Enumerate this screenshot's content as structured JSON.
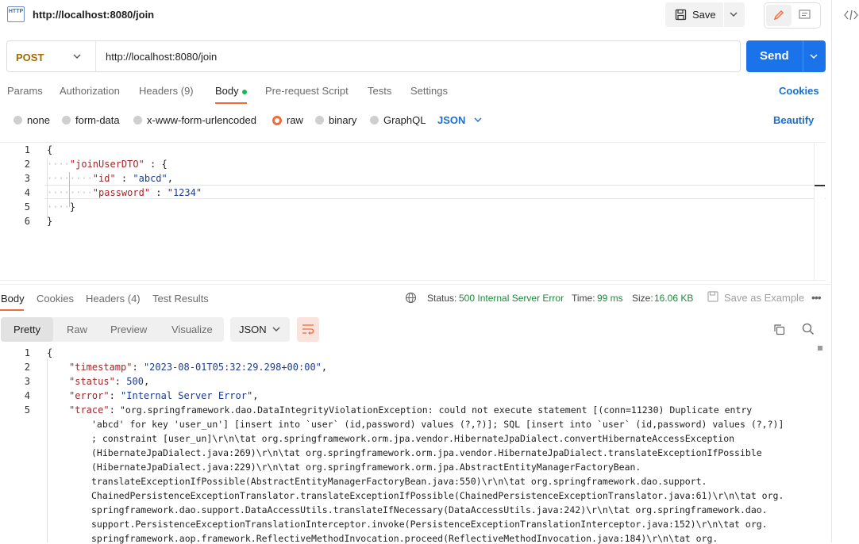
{
  "tab": {
    "icon_text": "HTTP",
    "title": "http://localhost:8080/join"
  },
  "toolbar": {
    "save_label": "Save"
  },
  "request": {
    "method": "POST",
    "url": "http://localhost:8080/join",
    "send_label": "Send"
  },
  "request_tabs": {
    "params": "Params",
    "authorization": "Authorization",
    "headers": "Headers (9)",
    "body": "Body",
    "prerequest": "Pre-request Script",
    "tests": "Tests",
    "settings": "Settings",
    "cookies": "Cookies"
  },
  "body_types": {
    "none": "none",
    "form_data": "form-data",
    "urlencoded": "x-www-form-urlencoded",
    "raw": "raw",
    "binary": "binary",
    "graphql": "GraphQL",
    "format": "JSON",
    "beautify": "Beautify"
  },
  "request_body": {
    "line_numbers": [
      "1",
      "2",
      "3",
      "4",
      "5",
      "6"
    ],
    "l1": "{",
    "l2_key": "\"joinUserDTO\"",
    "l2_rest": " : {",
    "l3_key": "\"id\"",
    "l3_colon": " : ",
    "l3_val": "\"abcd\"",
    "l3_comma": ",",
    "l4_key": "\"password\"",
    "l4_colon": " : ",
    "l4_val": "\"1234\"",
    "l5": "}",
    "l6": "}"
  },
  "response_tabs": {
    "body": "Body",
    "cookies": "Cookies",
    "headers": "Headers (4)",
    "test_results": "Test Results"
  },
  "response_meta": {
    "status_label": "Status:",
    "status_value": "500 Internal Server Error",
    "time_label": "Time:",
    "time_value": "99 ms",
    "size_label": "Size:",
    "size_value": "16.06 KB",
    "save_example": "Save as Example"
  },
  "view_modes": {
    "pretty": "Pretty",
    "raw": "Raw",
    "preview": "Preview",
    "visualize": "Visualize",
    "format": "JSON"
  },
  "response_body": {
    "line_numbers": [
      "1",
      "2",
      "3",
      "4",
      "5"
    ],
    "l1": "{",
    "l2_key": "\"timestamp\"",
    "l2_val": "\"2023-08-01T05:32:29.298+00:00\"",
    "l3_key": "\"status\"",
    "l3_val": "500",
    "l4_key": "\"error\"",
    "l4_val": "\"Internal Server Error\"",
    "l5_key": "\"trace\"",
    "trace_lines": [
      "\"org.springframework.dao.DataIntegrityViolationException: could not execute statement [(conn=11230) Duplicate entry",
      "'abcd' for key 'user_un'] [insert into `user` (id,password) values (?,?)]; SQL [insert into `user` (id,password) values (?,?)]",
      "; constraint [user_un]\\r\\n\\tat org.springframework.orm.jpa.vendor.HibernateJpaDialect.convertHibernateAccessException",
      "(HibernateJpaDialect.java:269)\\r\\n\\tat org.springframework.orm.jpa.vendor.HibernateJpaDialect.translateExceptionIfPossible",
      "(HibernateJpaDialect.java:229)\\r\\n\\tat org.springframework.orm.jpa.AbstractEntityManagerFactoryBean.",
      "translateExceptionIfPossible(AbstractEntityManagerFactoryBean.java:550)\\r\\n\\tat org.springframework.dao.support.",
      "ChainedPersistenceExceptionTranslator.translateExceptionIfPossible(ChainedPersistenceExceptionTranslator.java:61)\\r\\n\\tat org.",
      "springframework.dao.support.DataAccessUtils.translateIfNecessary(DataAccessUtils.java:242)\\r\\n\\tat org.springframework.dao.",
      "support.PersistenceExceptionTranslationInterceptor.invoke(PersistenceExceptionTranslationInterceptor.java:152)\\r\\n\\tat org.",
      "springframework.aop.framework.ReflectiveMethodInvocation.proceed(ReflectiveMethodInvocation.java:184)\\r\\n\\tat org."
    ]
  },
  "colors": {
    "accent": "#f26b3a",
    "send": "#1a73e8",
    "method": "#a36b00",
    "status_error": "#1b8a3a"
  }
}
